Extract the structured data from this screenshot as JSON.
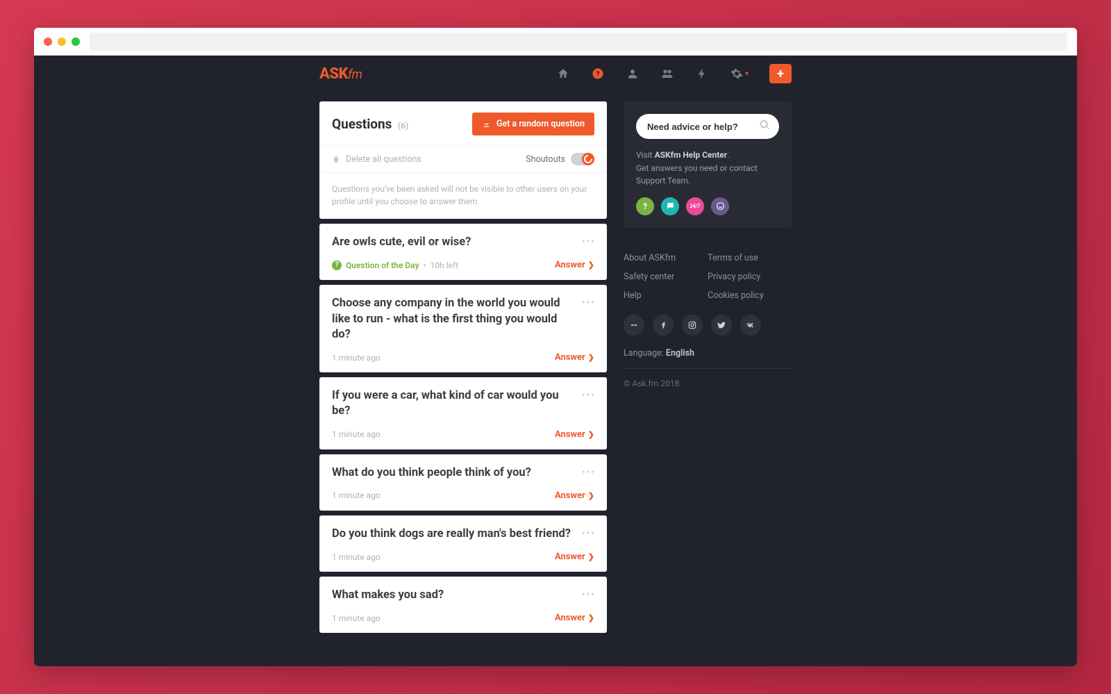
{
  "header": {
    "logo_main": "ASK",
    "logo_suffix": "fm"
  },
  "questions_panel": {
    "title": "Questions",
    "count": "(6)",
    "random_button": "Get a random question",
    "delete_all": "Delete all questions",
    "shoutouts_label": "Shoutouts",
    "hint": "Questions you've been asked will not be visible to other users on your profile until you choose to answer them"
  },
  "questions": [
    {
      "text": "Are owls cute, evil or wise?",
      "qod": true,
      "qod_label": "Question of the Day",
      "time": "10h left",
      "answer": "Answer"
    },
    {
      "text": "Choose any company in the world you would like to run - what is the first thing you would do?",
      "qod": false,
      "time": "1 minute ago",
      "answer": "Answer"
    },
    {
      "text": "If you were a car, what kind of car would you be?",
      "qod": false,
      "time": "1 minute ago",
      "answer": "Answer"
    },
    {
      "text": "What do you think people think of you?",
      "qod": false,
      "time": "1 minute ago",
      "answer": "Answer"
    },
    {
      "text": "Do you think dogs are really man's best friend?",
      "qod": false,
      "time": "1 minute ago",
      "answer": "Answer"
    },
    {
      "text": "What makes you sad?",
      "qod": false,
      "time": "1 minute ago",
      "answer": "Answer"
    }
  ],
  "help": {
    "search_placeholder": "Need advice or help?",
    "visit_prefix": "Visit ",
    "visit_link": "ASKfm Help Center",
    "visit_suffix": ".",
    "subtext": "Get answers you need or contact Support Team.",
    "pink_label": "24/7"
  },
  "footer": {
    "col1": [
      "About ASKfm",
      "Safety center",
      "Help"
    ],
    "col2": [
      "Terms of use",
      "Privacy policy",
      "Cookies policy"
    ],
    "language_label": "Language: ",
    "language_value": "English",
    "copyright": "© Ask.fm 2018"
  }
}
